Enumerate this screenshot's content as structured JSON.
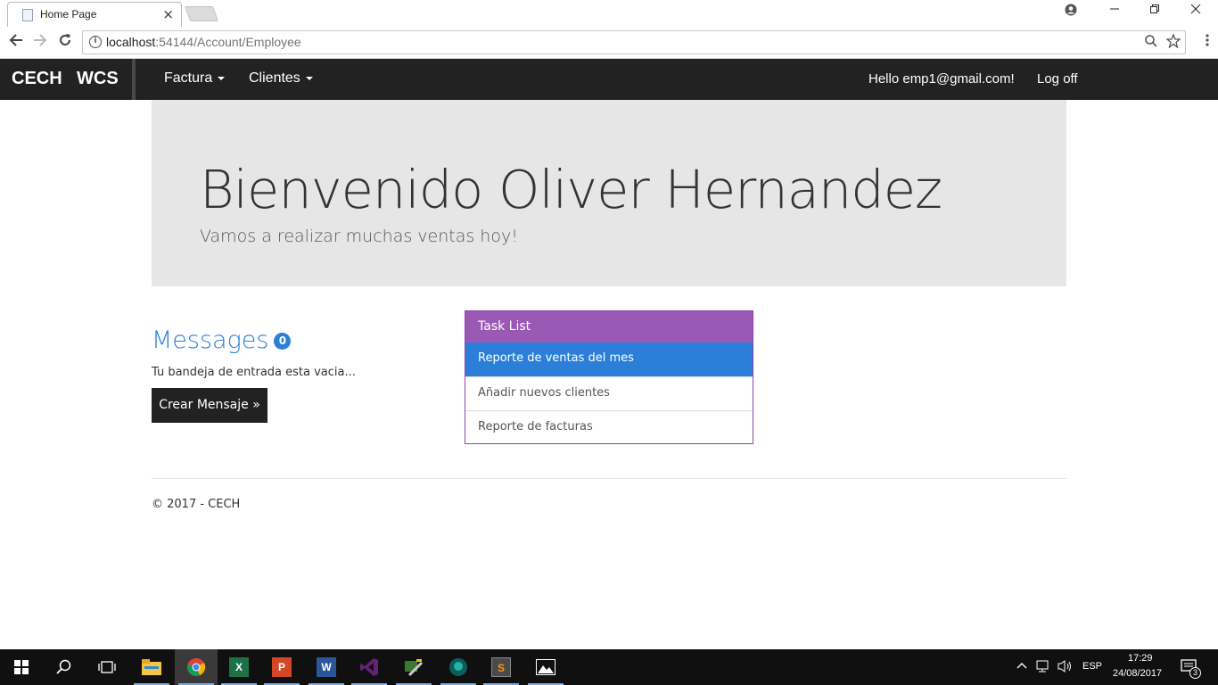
{
  "browser": {
    "tab_title": "Home Page",
    "tab_close": "×",
    "url_host": "localhost",
    "url_path": ":54144/Account/Employee"
  },
  "navbar": {
    "brand_part1": "CECH",
    "brand_part2": "WCS",
    "menu": [
      {
        "label": "Factura"
      },
      {
        "label": "Clientes"
      }
    ],
    "greeting": "Hello emp1@gmail.com!",
    "logoff": "Log off"
  },
  "jumbotron": {
    "heading": "Bienvenido Oliver Hernandez",
    "subtitle": "Vamos a realizar muchas ventas hoy!"
  },
  "messages": {
    "title": "Messages",
    "count": "0",
    "empty_text": "Tu bandeja de entrada esta vacia...",
    "create_button": "Crear Mensaje »"
  },
  "tasklist": {
    "title": "Task List",
    "items": [
      {
        "label": "Reporte de ventas del mes"
      },
      {
        "label": "Añadir nuevos clientes"
      },
      {
        "label": "Reporte de facturas"
      }
    ]
  },
  "footer": {
    "text": "© 2017 - CECH"
  },
  "taskbar": {
    "apps": [
      "file-explorer",
      "chrome",
      "excel",
      "powerpoint",
      "word",
      "visual-studio",
      "tool",
      "gitkraken",
      "sublime-text",
      "photos"
    ],
    "language": "ESP",
    "time": "17:29",
    "date": "24/08/2017",
    "notification_count": "3"
  },
  "colors": {
    "accent_blue": "#2b7fd9",
    "tasklist_purple": "#9b59b6",
    "navbar_bg": "#222222"
  }
}
